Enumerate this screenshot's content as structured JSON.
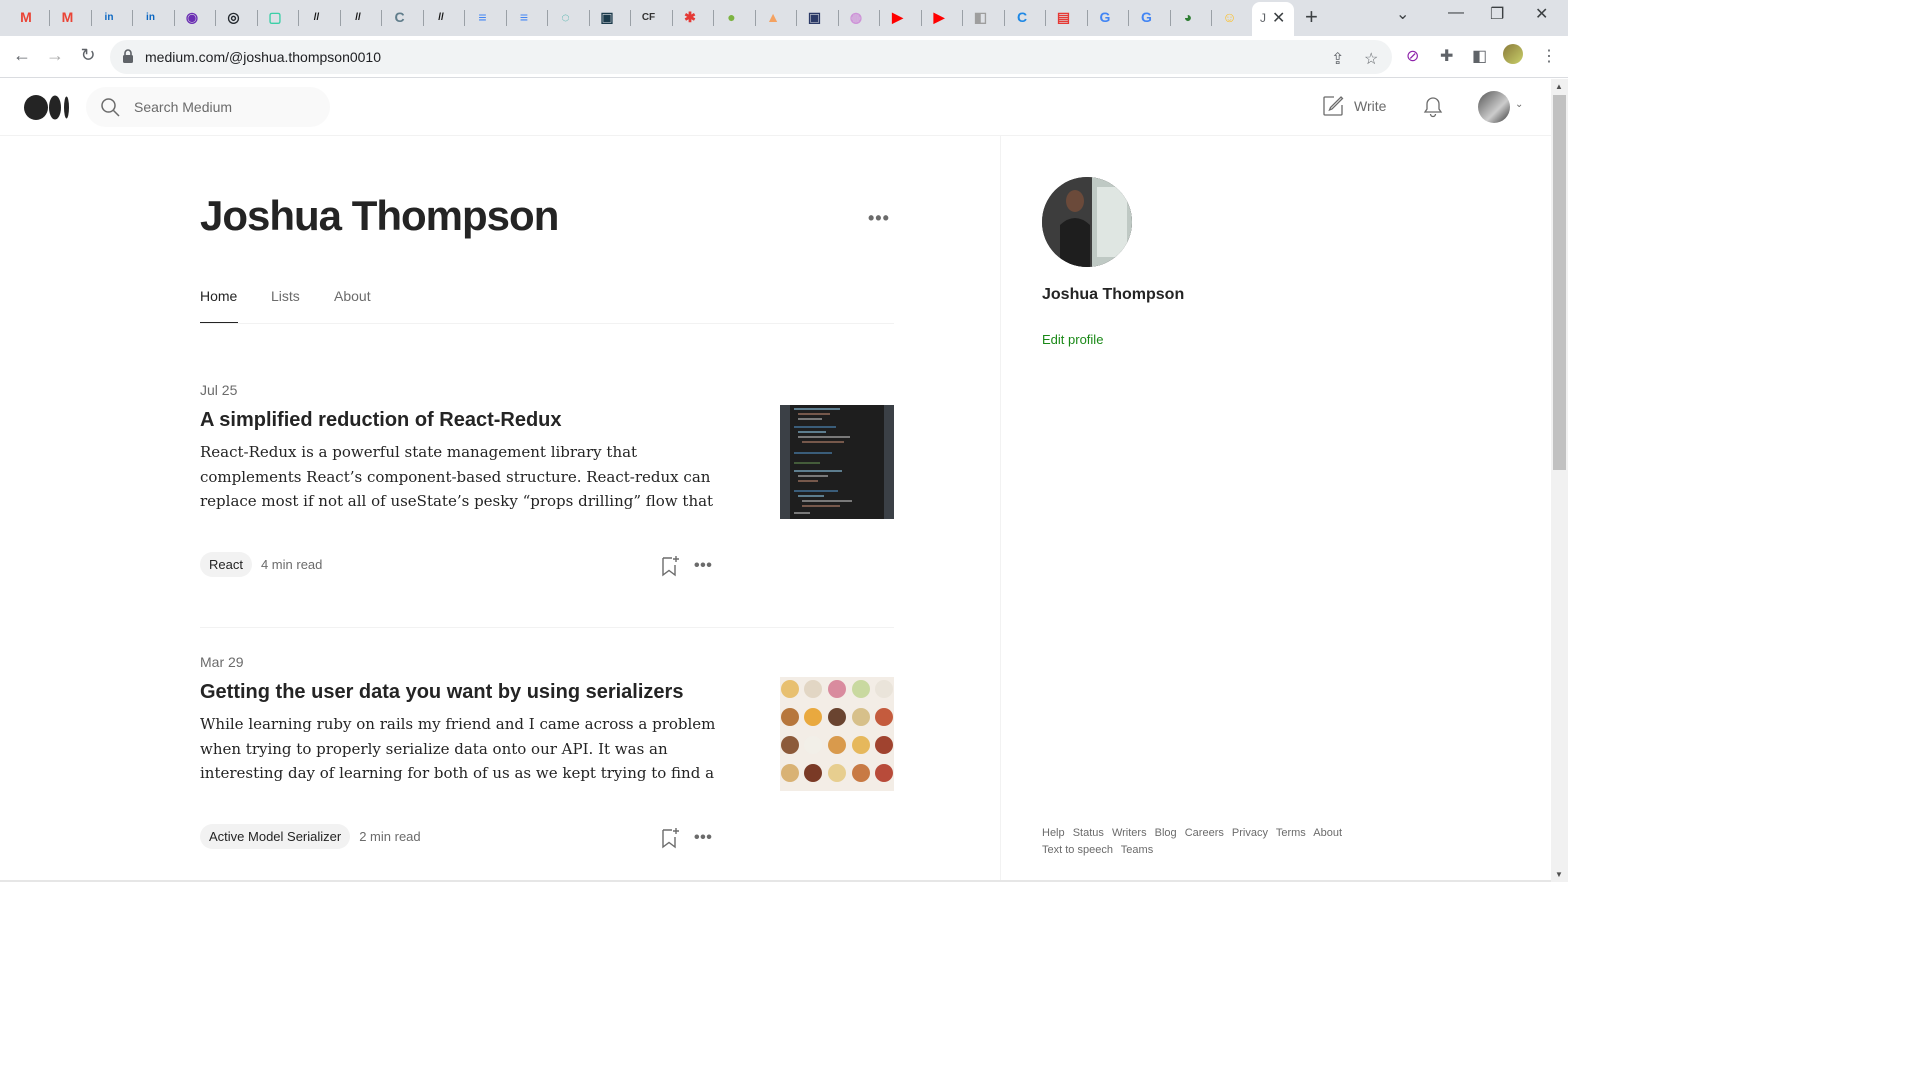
{
  "browser": {
    "favicons": [
      {
        "name": "gmail-icon",
        "glyph": "M",
        "color": "#ea4335"
      },
      {
        "name": "gmail-icon",
        "glyph": "M",
        "color": "#ea4335"
      },
      {
        "name": "linkedin-icon",
        "glyph": "in",
        "color": "#0a66c2"
      },
      {
        "name": "linkedin-icon",
        "glyph": "in",
        "color": "#0a66c2"
      },
      {
        "name": "app-icon",
        "glyph": "◉",
        "color": "#6b2fb3"
      },
      {
        "name": "github-icon",
        "glyph": "◎",
        "color": "#24292f"
      },
      {
        "name": "app-icon",
        "glyph": "▢",
        "color": "#3ccfa7"
      },
      {
        "name": "app-icon",
        "glyph": "//",
        "color": "#111"
      },
      {
        "name": "app-icon",
        "glyph": "//",
        "color": "#111"
      },
      {
        "name": "doc-icon",
        "glyph": "C",
        "color": "#607d8b"
      },
      {
        "name": "app-icon",
        "glyph": "//",
        "color": "#111"
      },
      {
        "name": "google-docs-icon",
        "glyph": "≡",
        "color": "#4285f4"
      },
      {
        "name": "google-docs-icon",
        "glyph": "≡",
        "color": "#4285f4"
      },
      {
        "name": "app-icon",
        "glyph": "◌",
        "color": "#26a69a"
      },
      {
        "name": "app-icon",
        "glyph": "▣",
        "color": "#1b3a4b"
      },
      {
        "name": "app-icon",
        "glyph": "CF",
        "color": "#333"
      },
      {
        "name": "app-icon",
        "glyph": "✱",
        "color": "#e53935"
      },
      {
        "name": "app-icon",
        "glyph": "●",
        "color": "#7cb342"
      },
      {
        "name": "app-icon",
        "glyph": "▲",
        "color": "#f4a261"
      },
      {
        "name": "app-icon",
        "glyph": "▣",
        "color": "#2b3a67"
      },
      {
        "name": "app-icon",
        "glyph": "◍",
        "color": "#ce93d8"
      },
      {
        "name": "youtube-icon",
        "glyph": "▶",
        "color": "#ff0000"
      },
      {
        "name": "youtube-icon",
        "glyph": "▶",
        "color": "#ff0000"
      },
      {
        "name": "app-icon",
        "glyph": "◧",
        "color": "#9e9e9e"
      },
      {
        "name": "app-icon",
        "glyph": "C",
        "color": "#1e88e5"
      },
      {
        "name": "app-icon",
        "glyph": "▤",
        "color": "#e53935"
      },
      {
        "name": "google-icon",
        "glyph": "G",
        "color": "#4285f4"
      },
      {
        "name": "google-icon",
        "glyph": "G",
        "color": "#4285f4"
      },
      {
        "name": "app-icon",
        "glyph": "◕",
        "color": "#2e7d32"
      },
      {
        "name": "emoji-icon",
        "glyph": "☺",
        "color": "#fbc02d"
      }
    ],
    "active_tab_favicon": "J",
    "url": "medium.com/@joshua.thompson0010"
  },
  "header": {
    "search_placeholder": "Search Medium",
    "write_label": "Write"
  },
  "profile": {
    "name": "Joshua Thompson",
    "tabs": [
      "Home",
      "Lists",
      "About"
    ],
    "active_tab": "Home"
  },
  "articles": [
    {
      "date": "Jul 25",
      "title": "A simplified reduction of React-Redux",
      "excerpt": "React-Redux is a powerful state management library that complements React’s component-based structure. React-redux can replace most if not all of useState’s pesky “props drilling” flow that can sometimes be…",
      "tag": "React",
      "read_time": "4 min read"
    },
    {
      "date": "Mar 29",
      "title": "Getting the user data you want by using serializers",
      "excerpt": "While learning ruby on rails my friend and I came across a problem when trying to properly serialize data onto our API. It was an interesting day of learning for both of us as we kept trying to find a w…",
      "tag": "Active Model Serializer",
      "read_time": "2 min read"
    }
  ],
  "sidebar": {
    "name": "Joshua Thompson",
    "edit_profile": "Edit profile",
    "footer_links": [
      "Help",
      "Status",
      "Writers",
      "Blog",
      "Careers",
      "Privacy",
      "Terms",
      "About",
      "Text to speech",
      "Teams"
    ]
  },
  "colors": {
    "accent_green": "#1a8917",
    "text_primary": "#242424",
    "text_secondary": "#6b6b6b"
  }
}
